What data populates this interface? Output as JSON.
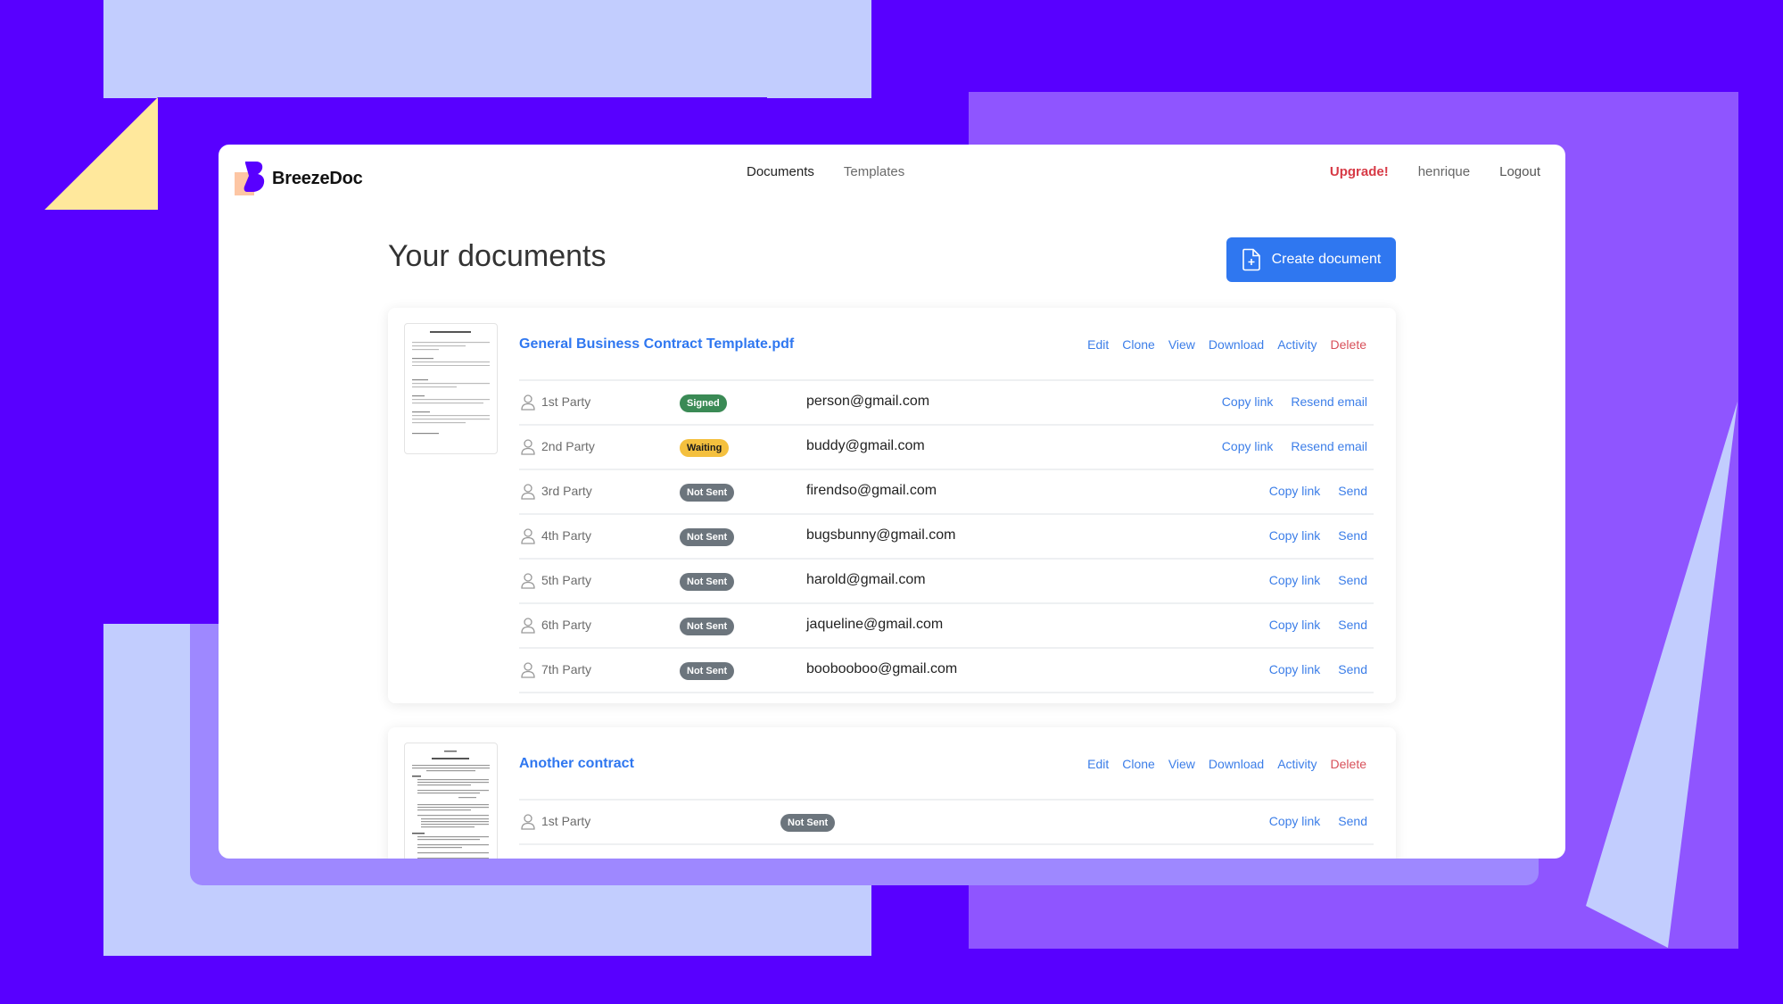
{
  "colors": {
    "brand_violet": "#5800ff",
    "accent_blue": "#2f77f0",
    "danger_red": "#d73a46",
    "signed_green": "#3a8a55",
    "waiting_yellow": "#f4c03e",
    "not_sent_gray": "#6c757d"
  },
  "app": {
    "name": "BreezeDoc",
    "logo_icon": "breezedoc-logo-icon"
  },
  "nav": {
    "links": [
      {
        "label": "Documents",
        "active": true
      },
      {
        "label": "Templates",
        "active": false
      }
    ],
    "upgrade": "Upgrade!",
    "username": "henrique",
    "logout": "Logout"
  },
  "page": {
    "title": "Your documents",
    "create_button": "Create document",
    "create_icon": "file-plus-icon"
  },
  "documents": [
    {
      "title": "General Business Contract Template.pdf",
      "actions": [
        "Edit",
        "Clone",
        "View",
        "Download",
        "Activity",
        "Delete"
      ],
      "parties": [
        {
          "name": "1st Party",
          "status": "Signed",
          "email": "person@gmail.com",
          "actions": [
            "Copy link",
            "Resend email"
          ]
        },
        {
          "name": "2nd Party",
          "status": "Waiting",
          "email": "buddy@gmail.com",
          "actions": [
            "Copy link",
            "Resend email"
          ]
        },
        {
          "name": "3rd Party",
          "status": "Not Sent",
          "email": "firendso@gmail.com",
          "actions": [
            "Copy link",
            "Send"
          ]
        },
        {
          "name": "4th Party",
          "status": "Not Sent",
          "email": "bugsbunny@gmail.com",
          "actions": [
            "Copy link",
            "Send"
          ]
        },
        {
          "name": "5th Party",
          "status": "Not Sent",
          "email": "harold@gmail.com",
          "actions": [
            "Copy link",
            "Send"
          ]
        },
        {
          "name": "6th Party",
          "status": "Not Sent",
          "email": "jaqueline@gmail.com",
          "actions": [
            "Copy link",
            "Send"
          ]
        },
        {
          "name": "7th Party",
          "status": "Not Sent",
          "email": "boobooboo@gmail.com",
          "actions": [
            "Copy link",
            "Send"
          ]
        }
      ]
    },
    {
      "title": "Another contract",
      "actions": [
        "Edit",
        "Clone",
        "View",
        "Download",
        "Activity",
        "Delete"
      ],
      "parties": [
        {
          "name": "1st Party",
          "status": "Not Sent",
          "email": "",
          "actions": [
            "Copy link",
            "Send"
          ]
        }
      ]
    }
  ]
}
